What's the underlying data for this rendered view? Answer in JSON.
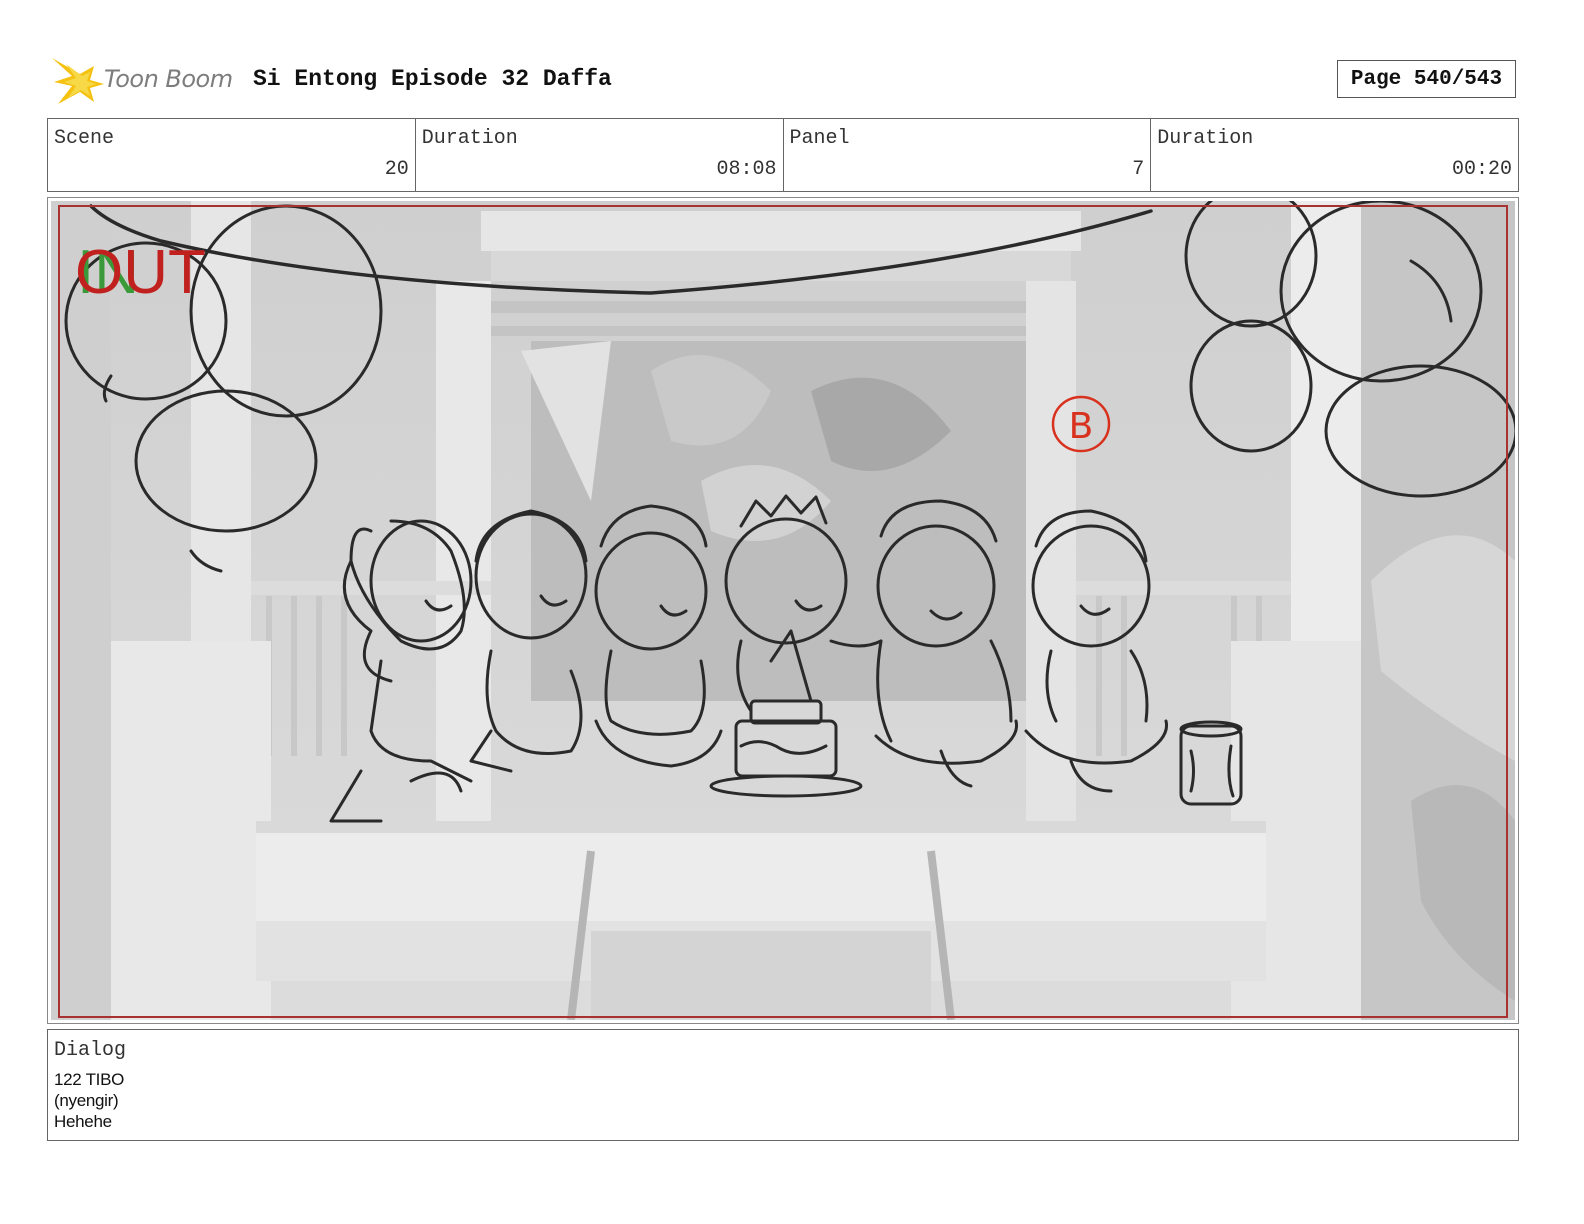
{
  "header": {
    "logo_text": "Toon Boom",
    "title": "Si Entong Episode 32 Daffa",
    "page": "Page 540/543"
  },
  "info": {
    "scene_label": "Scene",
    "scene_value": "20",
    "scene_duration_label": "Duration",
    "scene_duration_value": "08:08",
    "panel_label": "Panel",
    "panel_value": "7",
    "panel_duration_label": "Duration",
    "panel_duration_value": "00:20"
  },
  "panel": {
    "in_marker": "IN",
    "out_marker": "OUT",
    "annotation": "B"
  },
  "dialog": {
    "label": "Dialog",
    "lines": [
      "122 TIBO",
      "(nyengir)",
      "Hehehe"
    ]
  },
  "colors": {
    "out_marker": "#c0201e",
    "in_marker": "#3a9a3a",
    "logo_accent": "#f5c211",
    "frame_line": "#a83232"
  }
}
